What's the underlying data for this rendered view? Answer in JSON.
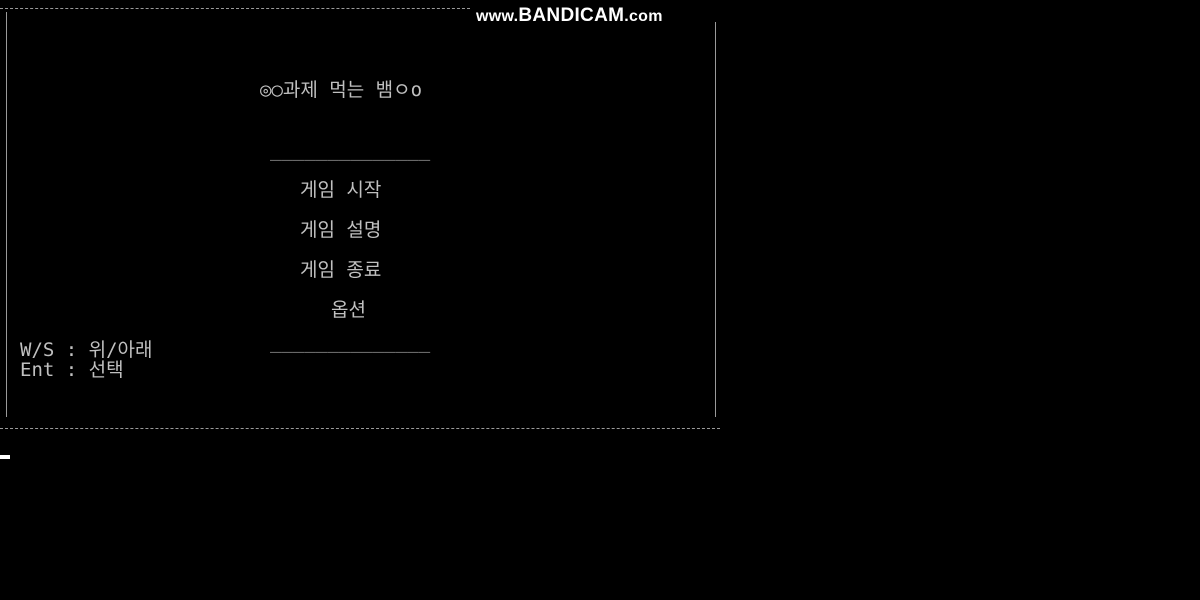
{
  "watermark": {
    "prefix": "www.",
    "brand": "BANDICAM",
    "suffix": ".com"
  },
  "title": "◎○과제 먹는 뱀ㅇo",
  "menu": {
    "items": [
      {
        "label": "게임 시작"
      },
      {
        "label": "게임 설명"
      },
      {
        "label": "게임 종료"
      },
      {
        "label": "옵션"
      }
    ],
    "divider": "______________"
  },
  "controls": {
    "move": "W/S : 위/아래",
    "select": "Ent : 선택"
  },
  "colors": {
    "background": "#000000",
    "text": "#c0c0c0",
    "border": "#9a9a9a",
    "watermark": "#ffffff"
  }
}
